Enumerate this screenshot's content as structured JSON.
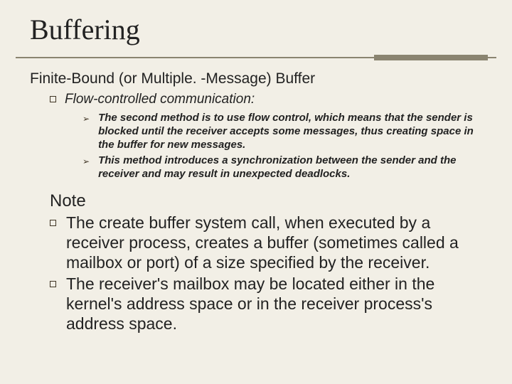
{
  "title": "Buffering",
  "subtitle": "Finite-Bound (or Multiple. -Message) Buffer",
  "level1": {
    "flow_item": "Flow-controlled communication:"
  },
  "level2": {
    "arrow_glyph": "➢",
    "item1": "The second method is to use flow control, which means that the sender is blocked until the receiver accepts some messages, thus creating space in the buffer for new messages.",
    "item2": "This method introduces a synchronization between the sender and the receiver and may result in unexpected deadlocks."
  },
  "note": {
    "heading": "Note",
    "item1": "The create buffer system call, when executed by a receiver process, creates a buffer (sometimes called a mailbox or port) of a size specified by the receiver.",
    "item2": "The receiver's mailbox may be located either in the kernel's address space or in the receiver process's address space."
  }
}
